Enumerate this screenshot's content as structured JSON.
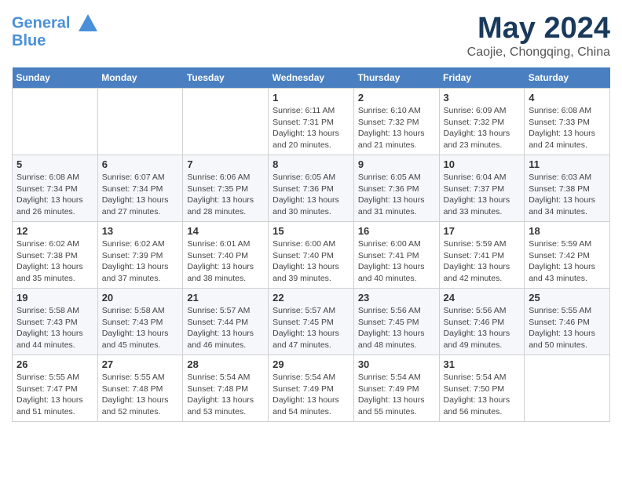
{
  "header": {
    "logo_line1": "General",
    "logo_line2": "Blue",
    "month": "May 2024",
    "location": "Caojie, Chongqing, China"
  },
  "weekdays": [
    "Sunday",
    "Monday",
    "Tuesday",
    "Wednesday",
    "Thursday",
    "Friday",
    "Saturday"
  ],
  "weeks": [
    [
      {
        "day": "",
        "info": ""
      },
      {
        "day": "",
        "info": ""
      },
      {
        "day": "",
        "info": ""
      },
      {
        "day": "1",
        "info": "Sunrise: 6:11 AM\nSunset: 7:31 PM\nDaylight: 13 hours\nand 20 minutes."
      },
      {
        "day": "2",
        "info": "Sunrise: 6:10 AM\nSunset: 7:32 PM\nDaylight: 13 hours\nand 21 minutes."
      },
      {
        "day": "3",
        "info": "Sunrise: 6:09 AM\nSunset: 7:32 PM\nDaylight: 13 hours\nand 23 minutes."
      },
      {
        "day": "4",
        "info": "Sunrise: 6:08 AM\nSunset: 7:33 PM\nDaylight: 13 hours\nand 24 minutes."
      }
    ],
    [
      {
        "day": "5",
        "info": "Sunrise: 6:08 AM\nSunset: 7:34 PM\nDaylight: 13 hours\nand 26 minutes."
      },
      {
        "day": "6",
        "info": "Sunrise: 6:07 AM\nSunset: 7:34 PM\nDaylight: 13 hours\nand 27 minutes."
      },
      {
        "day": "7",
        "info": "Sunrise: 6:06 AM\nSunset: 7:35 PM\nDaylight: 13 hours\nand 28 minutes."
      },
      {
        "day": "8",
        "info": "Sunrise: 6:05 AM\nSunset: 7:36 PM\nDaylight: 13 hours\nand 30 minutes."
      },
      {
        "day": "9",
        "info": "Sunrise: 6:05 AM\nSunset: 7:36 PM\nDaylight: 13 hours\nand 31 minutes."
      },
      {
        "day": "10",
        "info": "Sunrise: 6:04 AM\nSunset: 7:37 PM\nDaylight: 13 hours\nand 33 minutes."
      },
      {
        "day": "11",
        "info": "Sunrise: 6:03 AM\nSunset: 7:38 PM\nDaylight: 13 hours\nand 34 minutes."
      }
    ],
    [
      {
        "day": "12",
        "info": "Sunrise: 6:02 AM\nSunset: 7:38 PM\nDaylight: 13 hours\nand 35 minutes."
      },
      {
        "day": "13",
        "info": "Sunrise: 6:02 AM\nSunset: 7:39 PM\nDaylight: 13 hours\nand 37 minutes."
      },
      {
        "day": "14",
        "info": "Sunrise: 6:01 AM\nSunset: 7:40 PM\nDaylight: 13 hours\nand 38 minutes."
      },
      {
        "day": "15",
        "info": "Sunrise: 6:00 AM\nSunset: 7:40 PM\nDaylight: 13 hours\nand 39 minutes."
      },
      {
        "day": "16",
        "info": "Sunrise: 6:00 AM\nSunset: 7:41 PM\nDaylight: 13 hours\nand 40 minutes."
      },
      {
        "day": "17",
        "info": "Sunrise: 5:59 AM\nSunset: 7:41 PM\nDaylight: 13 hours\nand 42 minutes."
      },
      {
        "day": "18",
        "info": "Sunrise: 5:59 AM\nSunset: 7:42 PM\nDaylight: 13 hours\nand 43 minutes."
      }
    ],
    [
      {
        "day": "19",
        "info": "Sunrise: 5:58 AM\nSunset: 7:43 PM\nDaylight: 13 hours\nand 44 minutes."
      },
      {
        "day": "20",
        "info": "Sunrise: 5:58 AM\nSunset: 7:43 PM\nDaylight: 13 hours\nand 45 minutes."
      },
      {
        "day": "21",
        "info": "Sunrise: 5:57 AM\nSunset: 7:44 PM\nDaylight: 13 hours\nand 46 minutes."
      },
      {
        "day": "22",
        "info": "Sunrise: 5:57 AM\nSunset: 7:45 PM\nDaylight: 13 hours\nand 47 minutes."
      },
      {
        "day": "23",
        "info": "Sunrise: 5:56 AM\nSunset: 7:45 PM\nDaylight: 13 hours\nand 48 minutes."
      },
      {
        "day": "24",
        "info": "Sunrise: 5:56 AM\nSunset: 7:46 PM\nDaylight: 13 hours\nand 49 minutes."
      },
      {
        "day": "25",
        "info": "Sunrise: 5:55 AM\nSunset: 7:46 PM\nDaylight: 13 hours\nand 50 minutes."
      }
    ],
    [
      {
        "day": "26",
        "info": "Sunrise: 5:55 AM\nSunset: 7:47 PM\nDaylight: 13 hours\nand 51 minutes."
      },
      {
        "day": "27",
        "info": "Sunrise: 5:55 AM\nSunset: 7:48 PM\nDaylight: 13 hours\nand 52 minutes."
      },
      {
        "day": "28",
        "info": "Sunrise: 5:54 AM\nSunset: 7:48 PM\nDaylight: 13 hours\nand 53 minutes."
      },
      {
        "day": "29",
        "info": "Sunrise: 5:54 AM\nSunset: 7:49 PM\nDaylight: 13 hours\nand 54 minutes."
      },
      {
        "day": "30",
        "info": "Sunrise: 5:54 AM\nSunset: 7:49 PM\nDaylight: 13 hours\nand 55 minutes."
      },
      {
        "day": "31",
        "info": "Sunrise: 5:54 AM\nSunset: 7:50 PM\nDaylight: 13 hours\nand 56 minutes."
      },
      {
        "day": "",
        "info": ""
      }
    ]
  ]
}
